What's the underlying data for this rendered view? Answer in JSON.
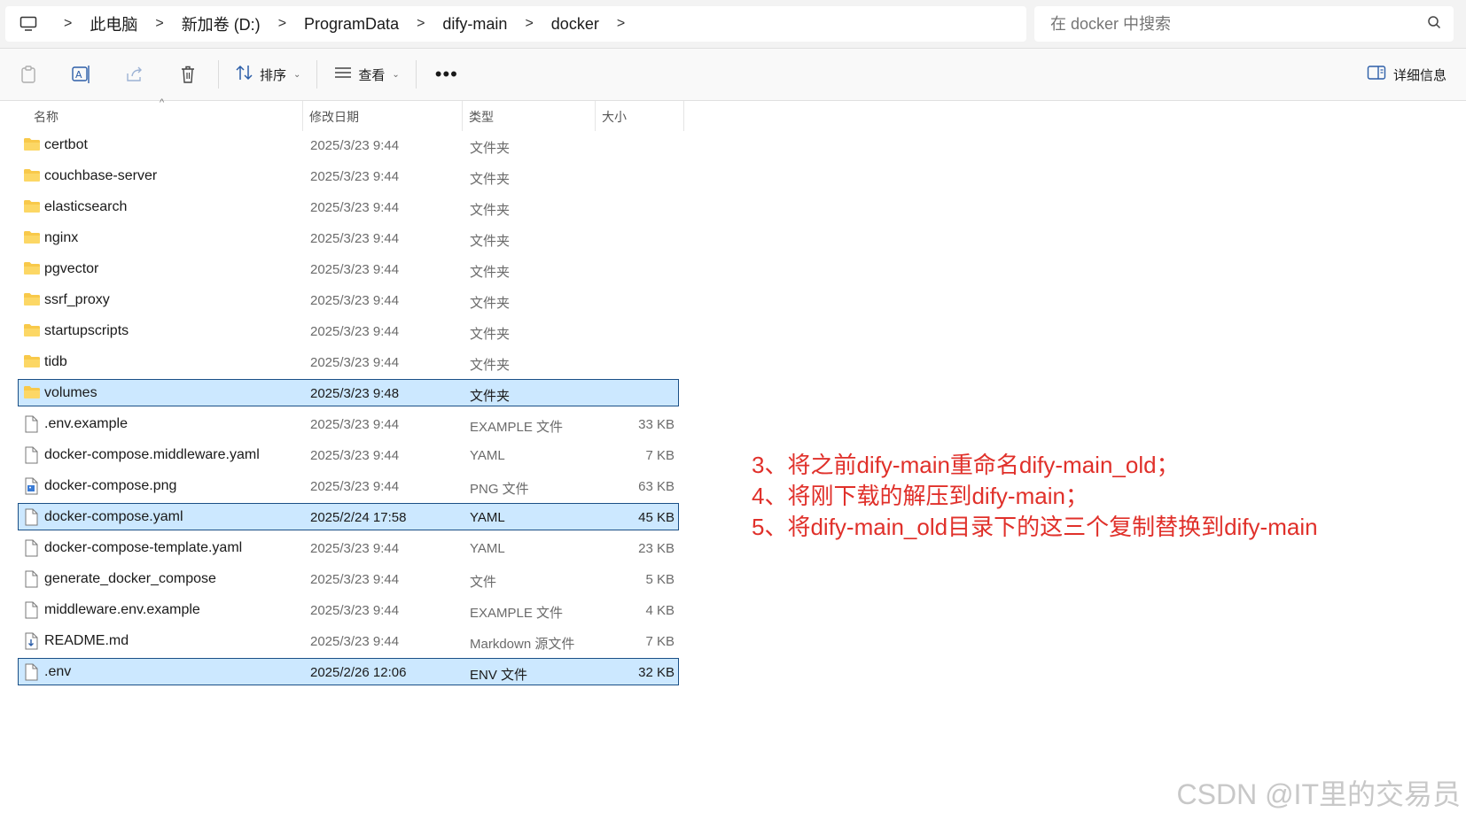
{
  "address_bar": {
    "crumbs": [
      "此电脑",
      "新加卷 (D:)",
      "ProgramData",
      "dify-main",
      "docker"
    ],
    "separator": ">"
  },
  "search": {
    "placeholder": "在 docker 中搜索"
  },
  "toolbar": {
    "sort_label": "排序",
    "view_label": "查看",
    "more_label": "•••",
    "details_label": "详细信息"
  },
  "columns": {
    "name": "名称",
    "date": "修改日期",
    "type": "类型",
    "size": "大小"
  },
  "files": [
    {
      "name": "certbot",
      "date": "2025/3/23 9:44",
      "type": "文件夹",
      "size": "",
      "kind": "folder",
      "selected": false
    },
    {
      "name": "couchbase-server",
      "date": "2025/3/23 9:44",
      "type": "文件夹",
      "size": "",
      "kind": "folder",
      "selected": false
    },
    {
      "name": "elasticsearch",
      "date": "2025/3/23 9:44",
      "type": "文件夹",
      "size": "",
      "kind": "folder",
      "selected": false
    },
    {
      "name": "nginx",
      "date": "2025/3/23 9:44",
      "type": "文件夹",
      "size": "",
      "kind": "folder",
      "selected": false
    },
    {
      "name": "pgvector",
      "date": "2025/3/23 9:44",
      "type": "文件夹",
      "size": "",
      "kind": "folder",
      "selected": false
    },
    {
      "name": "ssrf_proxy",
      "date": "2025/3/23 9:44",
      "type": "文件夹",
      "size": "",
      "kind": "folder",
      "selected": false
    },
    {
      "name": "startupscripts",
      "date": "2025/3/23 9:44",
      "type": "文件夹",
      "size": "",
      "kind": "folder",
      "selected": false
    },
    {
      "name": "tidb",
      "date": "2025/3/23 9:44",
      "type": "文件夹",
      "size": "",
      "kind": "folder",
      "selected": false
    },
    {
      "name": "volumes",
      "date": "2025/3/23 9:48",
      "type": "文件夹",
      "size": "",
      "kind": "folder",
      "selected": true
    },
    {
      "name": ".env.example",
      "date": "2025/3/23 9:44",
      "type": "EXAMPLE 文件",
      "size": "33 KB",
      "kind": "file",
      "selected": false
    },
    {
      "name": "docker-compose.middleware.yaml",
      "date": "2025/3/23 9:44",
      "type": "YAML",
      "size": "7 KB",
      "kind": "file",
      "selected": false
    },
    {
      "name": "docker-compose.png",
      "date": "2025/3/23 9:44",
      "type": "PNG 文件",
      "size": "63 KB",
      "kind": "image",
      "selected": false
    },
    {
      "name": "docker-compose.yaml",
      "date": "2025/2/24 17:58",
      "type": "YAML",
      "size": "45 KB",
      "kind": "file",
      "selected": true
    },
    {
      "name": "docker-compose-template.yaml",
      "date": "2025/3/23 9:44",
      "type": "YAML",
      "size": "23 KB",
      "kind": "file",
      "selected": false
    },
    {
      "name": "generate_docker_compose",
      "date": "2025/3/23 9:44",
      "type": "文件",
      "size": "5 KB",
      "kind": "file",
      "selected": false
    },
    {
      "name": "middleware.env.example",
      "date": "2025/3/23 9:44",
      "type": "EXAMPLE 文件",
      "size": "4 KB",
      "kind": "file",
      "selected": false
    },
    {
      "name": "README.md",
      "date": "2025/3/23 9:44",
      "type": "Markdown 源文件",
      "size": "7 KB",
      "kind": "markdown",
      "selected": false
    },
    {
      "name": ".env",
      "date": "2025/2/26 12:06",
      "type": "ENV 文件",
      "size": "32 KB",
      "kind": "file",
      "selected": true
    }
  ],
  "annotation": {
    "lines": [
      "3、将之前dify-main重命名dify-main_old；",
      "4、将刚下载的解压到dify-main；",
      "5、将dify-main_old目录下的这三个复制替换到dify-main"
    ],
    "color": "#e0302a"
  },
  "watermark": "CSDN @IT里的交易员",
  "colors": {
    "selection_bg": "#cce8ff",
    "selection_border": "#1a4f86",
    "folder": "#f8c94a"
  }
}
